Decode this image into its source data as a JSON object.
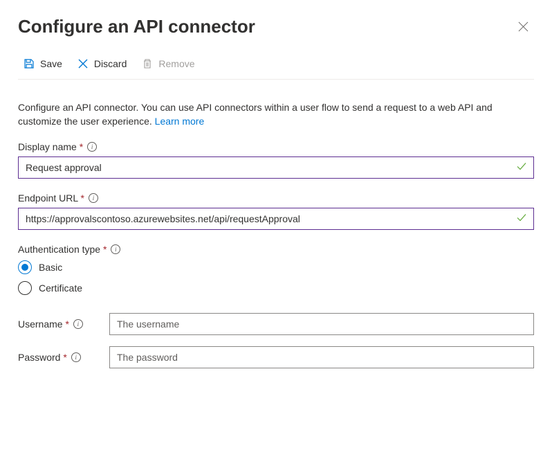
{
  "header": {
    "title": "Configure an API connector"
  },
  "toolbar": {
    "save": "Save",
    "discard": "Discard",
    "remove": "Remove"
  },
  "body": {
    "description_prefix": "Configure an API connector. You can use API connectors within a user flow to send a request to a web API and customize the user experience. ",
    "learn_more": "Learn more"
  },
  "fields": {
    "display_name": {
      "label": "Display name",
      "value": "Request approval"
    },
    "endpoint_url": {
      "label": "Endpoint URL",
      "value": "https://approvalscontoso.azurewebsites.net/api/requestApproval"
    },
    "auth_type": {
      "label": "Authentication type",
      "options": {
        "basic": "Basic",
        "certificate": "Certificate"
      },
      "selected": "basic"
    },
    "username": {
      "label": "Username",
      "placeholder": "The username"
    },
    "password": {
      "label": "Password",
      "placeholder": "The password"
    }
  }
}
